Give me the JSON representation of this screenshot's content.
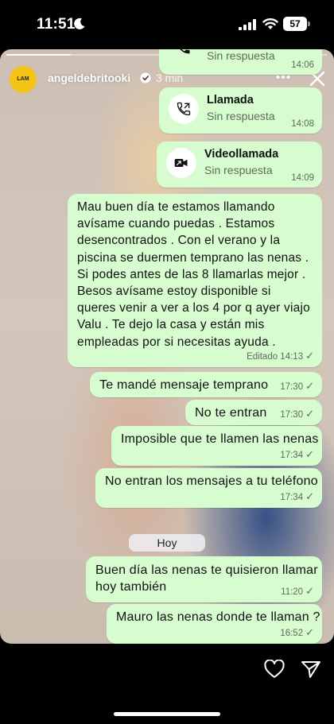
{
  "status_bar": {
    "time": "11:51",
    "battery": "57"
  },
  "story": {
    "progress": 0.2,
    "username": "angeldebritooki",
    "time_ago": "3 min",
    "avatar_text": "LAM",
    "icons": {
      "more": "more-icon",
      "close": "close-icon",
      "verified": "verified-icon",
      "like": "heart-icon",
      "share": "send-icon"
    }
  },
  "chat": {
    "calls": [
      {
        "title": "",
        "subtitle": "Sin respuesta",
        "time": "14:06",
        "icon": "phone-outgoing-icon"
      },
      {
        "title": "Llamada",
        "subtitle": "Sin respuesta",
        "time": "14:08",
        "icon": "phone-outgoing-icon"
      },
      {
        "title": "Videollamada",
        "subtitle": "Sin respuesta",
        "time": "14:09",
        "icon": "video-outgoing-icon"
      }
    ],
    "long_message": {
      "lines": [
        "Mau buen día te estamos llamando",
        "avísame cuando puedas . Estamos",
        "desencontrados  . Con el verano y la",
        "piscina se duermen temprano las nenas .",
        "Si podes antes de las 8 llamarlas mejor .",
        "Besos  avísame estoy disponible si",
        "queres venir a ver a los 4 por q ayer viajo",
        "Valu . Te dejo la casa  y están mis",
        "empleadas por si necesitas ayuda ."
      ],
      "meta": "Editado 14:13"
    },
    "messages": [
      {
        "text": "Te mandé mensaje temprano",
        "time": "17:30"
      },
      {
        "text": "No te entran",
        "time": "17:30"
      },
      {
        "text": "Imposible que te llamen las nenas",
        "time": "17:34"
      },
      {
        "text": "No entran los mensajes a tu teléfono",
        "time": "17:34"
      }
    ],
    "date_divider": "Hoy",
    "messages_today": [
      {
        "line1": "Buen día las nenas te quisieron llamar",
        "line2": "hoy también",
        "time": "11:20"
      },
      {
        "text": "Mauro las nenas donde te llaman ?",
        "time": "16:52"
      }
    ]
  }
}
